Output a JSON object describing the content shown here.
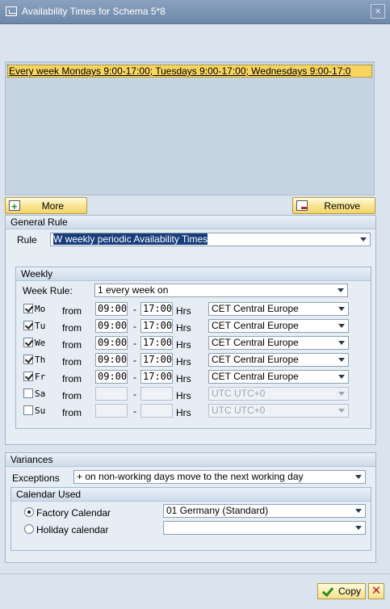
{
  "window": {
    "title": "Availability Times for Schema 5*8",
    "close_glyph": "×"
  },
  "rules_list": {
    "selected_item": "Every week Mondays  9:00-17:00; Tuesdays  9:00-17:00; Wednesdays  9:00-17:0"
  },
  "buttons": {
    "more": "More",
    "remove": "Remove",
    "copy": "Copy",
    "cancel_glyph": "✕"
  },
  "general_rule": {
    "header": "General Rule",
    "rule_label": "Rule",
    "rule_value": "W weekly periodic Availability Times"
  },
  "weekly": {
    "header": "Weekly",
    "week_rule_label": "Week Rule:",
    "week_rule_value": "1 every week on",
    "from_label": "from",
    "dash": "-",
    "hrs_label": "Hrs",
    "days": [
      {
        "label": "Mo",
        "checked": true,
        "from": "09:00",
        "to": "17:00",
        "tz": "CET Central Europe",
        "enabled": true
      },
      {
        "label": "Tu",
        "checked": true,
        "from": "09:00",
        "to": "17:00",
        "tz": "CET Central Europe",
        "enabled": true
      },
      {
        "label": "We",
        "checked": true,
        "from": "09:00",
        "to": "17:00",
        "tz": "CET Central Europe",
        "enabled": true
      },
      {
        "label": "Th",
        "checked": true,
        "from": "09:00",
        "to": "17:00",
        "tz": "CET Central Europe",
        "enabled": true
      },
      {
        "label": "Fr",
        "checked": true,
        "from": "09:00",
        "to": "17:00",
        "tz": "CET Central Europe",
        "enabled": true
      },
      {
        "label": "Sa",
        "checked": false,
        "from": "",
        "to": "",
        "tz": "UTC UTC+0",
        "enabled": false
      },
      {
        "label": "Su",
        "checked": false,
        "from": "",
        "to": "",
        "tz": "UTC UTC+0",
        "enabled": false
      }
    ]
  },
  "variances": {
    "header": "Variances",
    "exceptions_label": "Exceptions",
    "exceptions_value": "+ on non-working days move to the next working day"
  },
  "calendar_used": {
    "header": "Calendar Used",
    "factory_label": "Factory Calendar",
    "factory_value": "01 Germany (Standard)",
    "factory_selected": true,
    "holiday_label": "Holiday calendar",
    "holiday_value": ""
  }
}
